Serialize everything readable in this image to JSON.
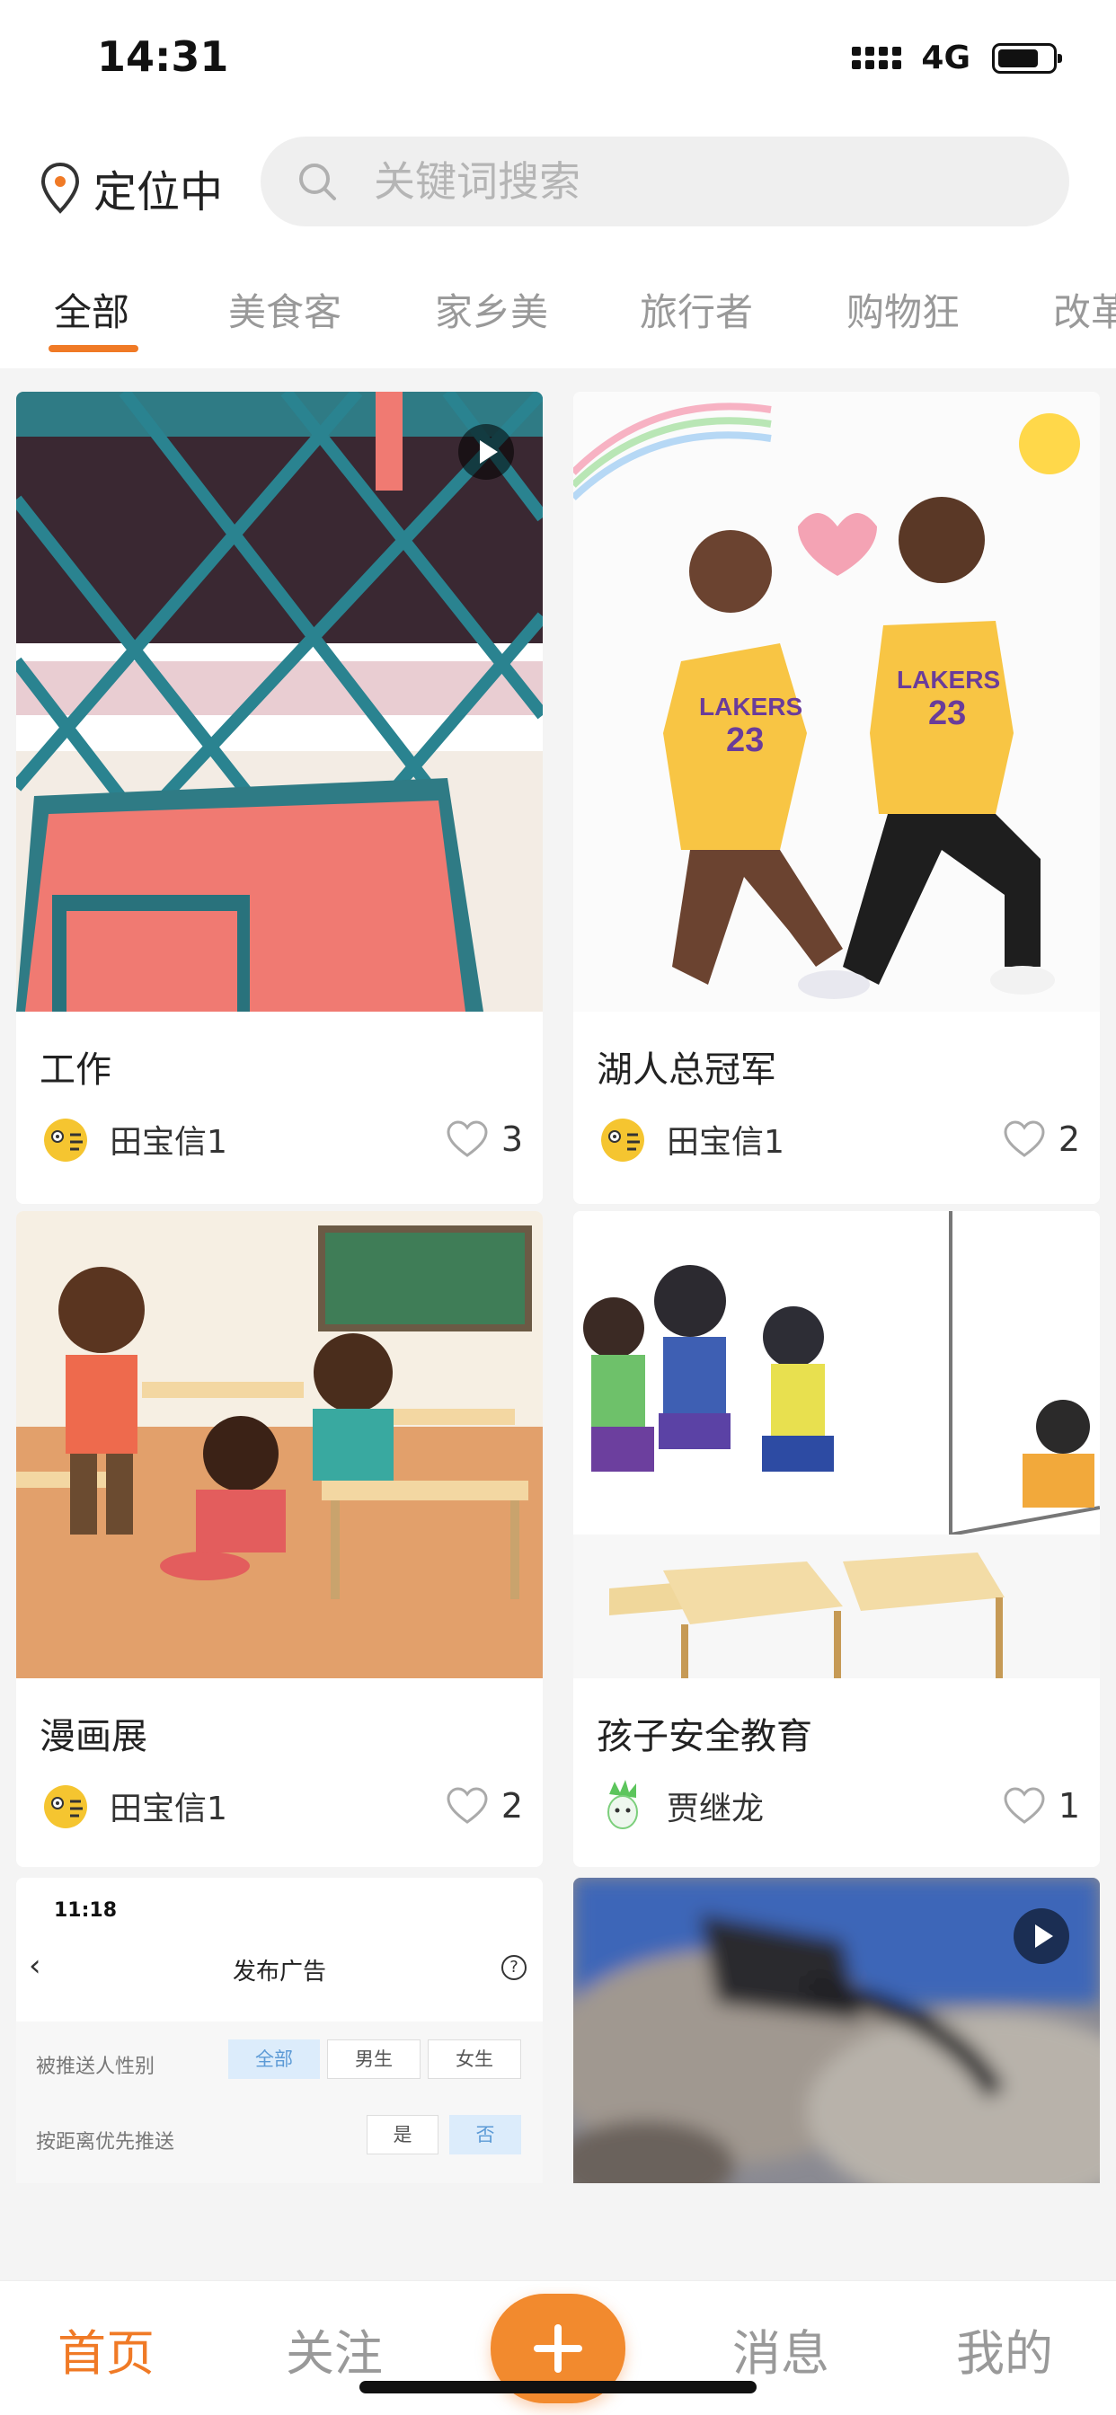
{
  "status_bar": {
    "time": "14:31",
    "network": "4G"
  },
  "location": {
    "label": "定位中"
  },
  "search": {
    "placeholder": "关键词搜索"
  },
  "tabs": [
    {
      "label": "全部",
      "active": true
    },
    {
      "label": "美食客",
      "active": false
    },
    {
      "label": "家乡美",
      "active": false
    },
    {
      "label": "旅行者",
      "active": false
    },
    {
      "label": "购物狂",
      "active": false
    },
    {
      "label": "改革",
      "active": false
    }
  ],
  "posts": [
    {
      "title": "工作",
      "author": "田宝信1",
      "likes": "3",
      "has_video": true
    },
    {
      "title": "湖人总冠军",
      "author": "田宝信1",
      "likes": "2",
      "has_video": false,
      "jersey_text": "LAKERS",
      "jersey_number": "23"
    },
    {
      "title": "漫画展",
      "author": "田宝信1",
      "likes": "2",
      "has_video": false
    },
    {
      "title": "孩子安全教育",
      "author": "贾继龙",
      "likes": "1",
      "has_video": false
    },
    {
      "has_video": false,
      "screenshot": {
        "time": "11:18",
        "title": "发布广告",
        "back_icon": "‹",
        "help_icon": "?",
        "row1_label": "被推送人性别",
        "row1_options": [
          "全部",
          "男生",
          "女生"
        ],
        "row2_label": "按距离优先推送",
        "row2_options": [
          "是",
          "否"
        ]
      }
    },
    {
      "has_video": true
    }
  ],
  "bottom_nav": {
    "home": "首页",
    "follow": "关注",
    "messages": "消息",
    "mine": "我的"
  },
  "colors": {
    "accent": "#f07a26",
    "inactive": "#999999"
  },
  "icons": [
    "location-pin-icon",
    "search-icon",
    "heart-icon",
    "play-icon",
    "plus-icon"
  ]
}
